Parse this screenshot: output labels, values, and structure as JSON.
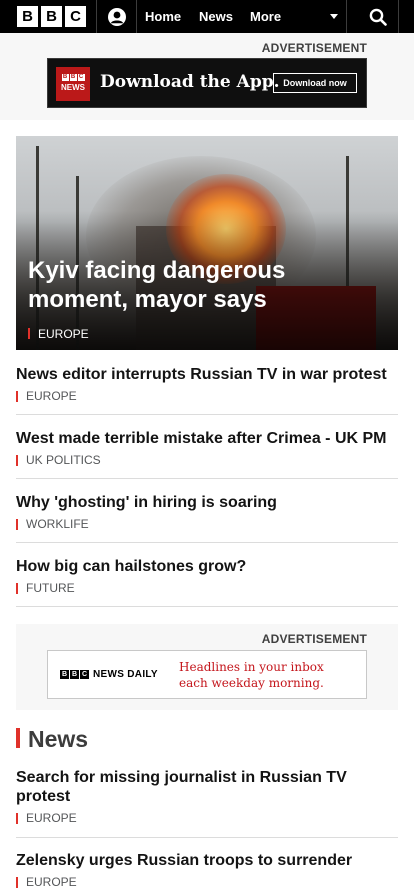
{
  "nav": {
    "logo_letters": [
      "B",
      "B",
      "C"
    ],
    "account_icon": "user-icon",
    "links": [
      "Home",
      "News",
      "More"
    ],
    "search_icon": "search-icon"
  },
  "ads": {
    "label": "ADVERTISEMENT",
    "app": {
      "badge_letters": [
        "B",
        "B",
        "C"
      ],
      "badge_text": "NEWS",
      "title": "Download the App.",
      "button": "Download now"
    },
    "daily": {
      "logo_letters": [
        "B",
        "B",
        "C"
      ],
      "logo_text": "NEWS DAILY",
      "line1": "Headlines in your inbox",
      "line2": "each weekday morning."
    }
  },
  "hero": {
    "title": "Kyiv facing dangerous moment, mayor says",
    "tag": "EUROPE"
  },
  "stories": [
    {
      "headline": "News editor interrupts Russian TV in war protest",
      "tag": "EUROPE"
    },
    {
      "headline": "West made terrible mistake after Crimea - UK PM",
      "tag": "UK POLITICS"
    },
    {
      "headline": "Why 'ghosting' in hiring is soaring",
      "tag": "WORKLIFE"
    },
    {
      "headline": "How big can hailstones grow?",
      "tag": "FUTURE"
    }
  ],
  "news_section": {
    "title": "News",
    "stories": [
      {
        "headline": "Search for missing journalist in Russian TV protest",
        "tag": "EUROPE"
      },
      {
        "headline": "Zelensky urges Russian troops to surrender",
        "tag": "EUROPE"
      }
    ]
  },
  "colors": {
    "accent": "#e0312a",
    "nav_bg": "#000000",
    "ad_red": "#c4161c"
  }
}
